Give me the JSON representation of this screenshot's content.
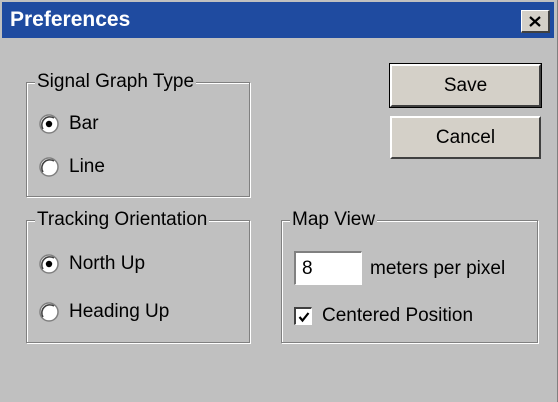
{
  "window": {
    "title": "Preferences",
    "close_icon": "close-x-icon"
  },
  "signal_graph": {
    "legend": "Signal Graph Type",
    "options": [
      {
        "label": "Bar",
        "selected": true
      },
      {
        "label": "Line",
        "selected": false
      }
    ]
  },
  "tracking": {
    "legend": "Tracking Orientation",
    "options": [
      {
        "label": "North Up",
        "selected": true
      },
      {
        "label": "Heading Up",
        "selected": false
      }
    ]
  },
  "map_view": {
    "legend": "Map View",
    "meters_value": "8",
    "meters_label": "meters per pixel",
    "centered_label": "Centered Position",
    "centered_checked": true
  },
  "buttons": {
    "save": "Save",
    "cancel": "Cancel"
  },
  "colors": {
    "titlebar": "#1f4ba0",
    "face": "#c0c0c0"
  }
}
